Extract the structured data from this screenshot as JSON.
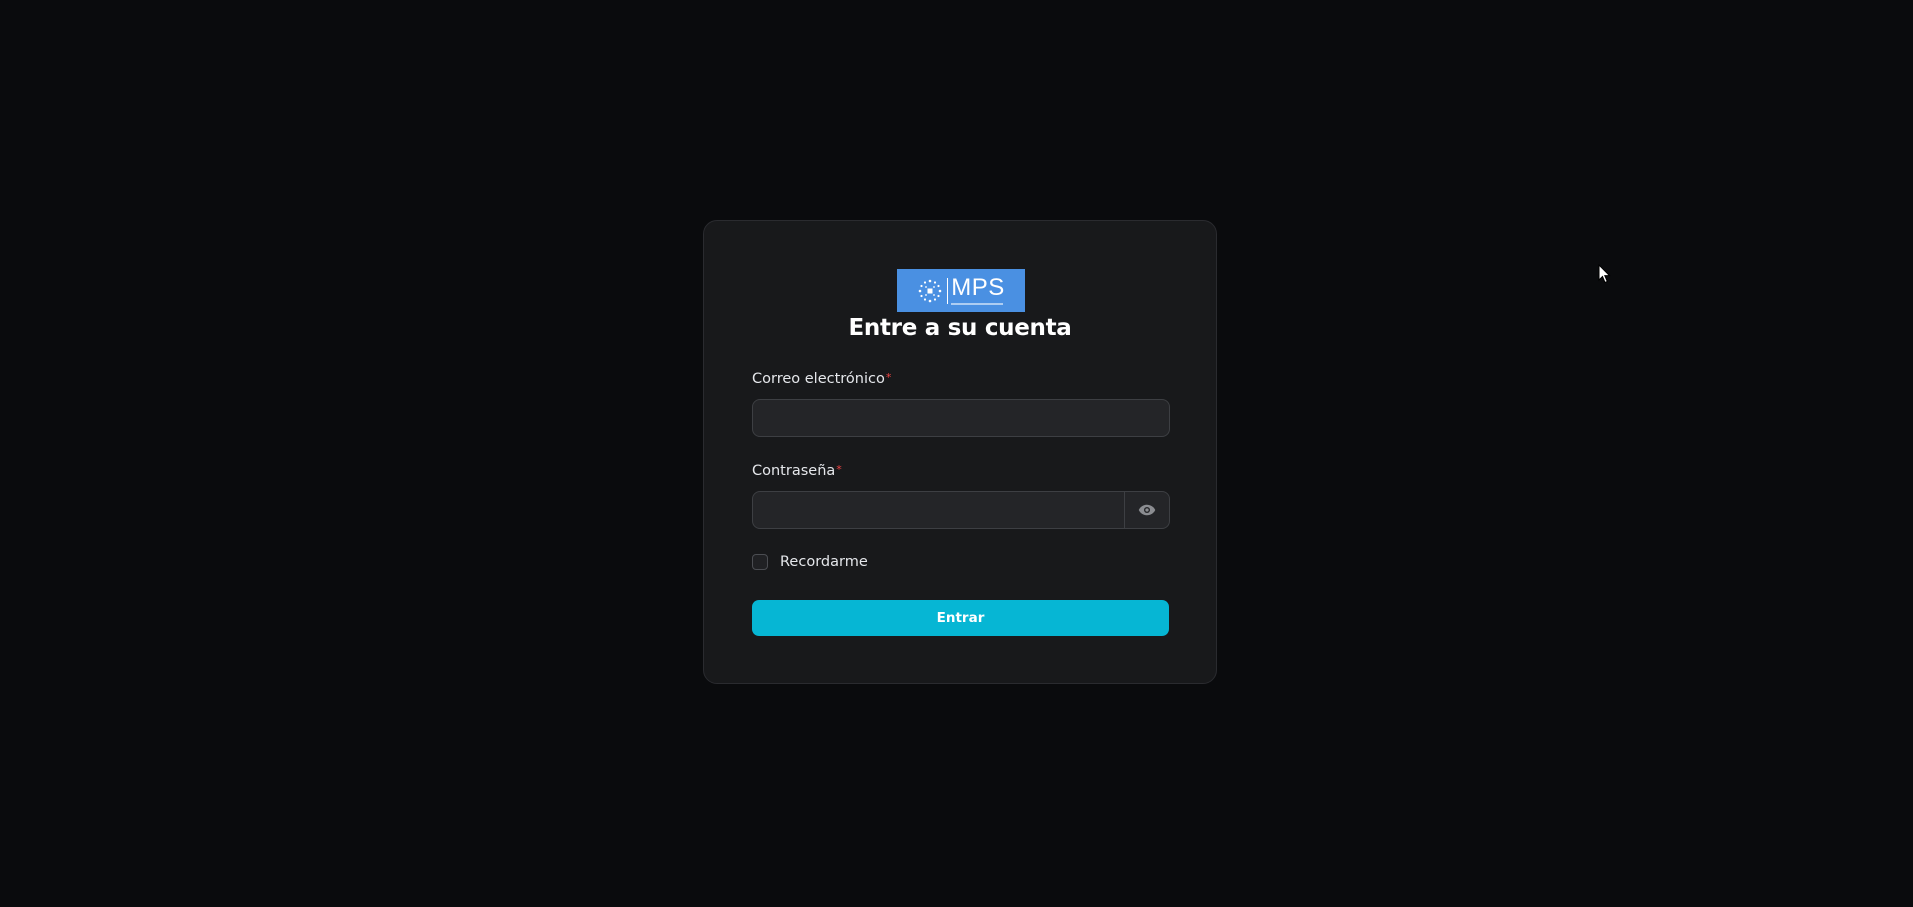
{
  "logo": {
    "text": "MPS"
  },
  "login": {
    "title": "Entre a su cuenta",
    "email_label": "Correo electrónico",
    "email_value": "",
    "password_label": "Contraseña",
    "password_value": "",
    "required_marker": "*",
    "remember_label": "Recordarme",
    "remember_checked": false,
    "submit_label": "Entrar"
  },
  "icons": {
    "password_toggle": "eye-icon",
    "pointer": "mouse-cursor-icon"
  },
  "colors": {
    "background": "#0a0b0d",
    "card": "#18191b",
    "input": "#242528",
    "accent": "#06b6d4",
    "logo_bg": "#4a90e2",
    "required": "#ef4444"
  }
}
